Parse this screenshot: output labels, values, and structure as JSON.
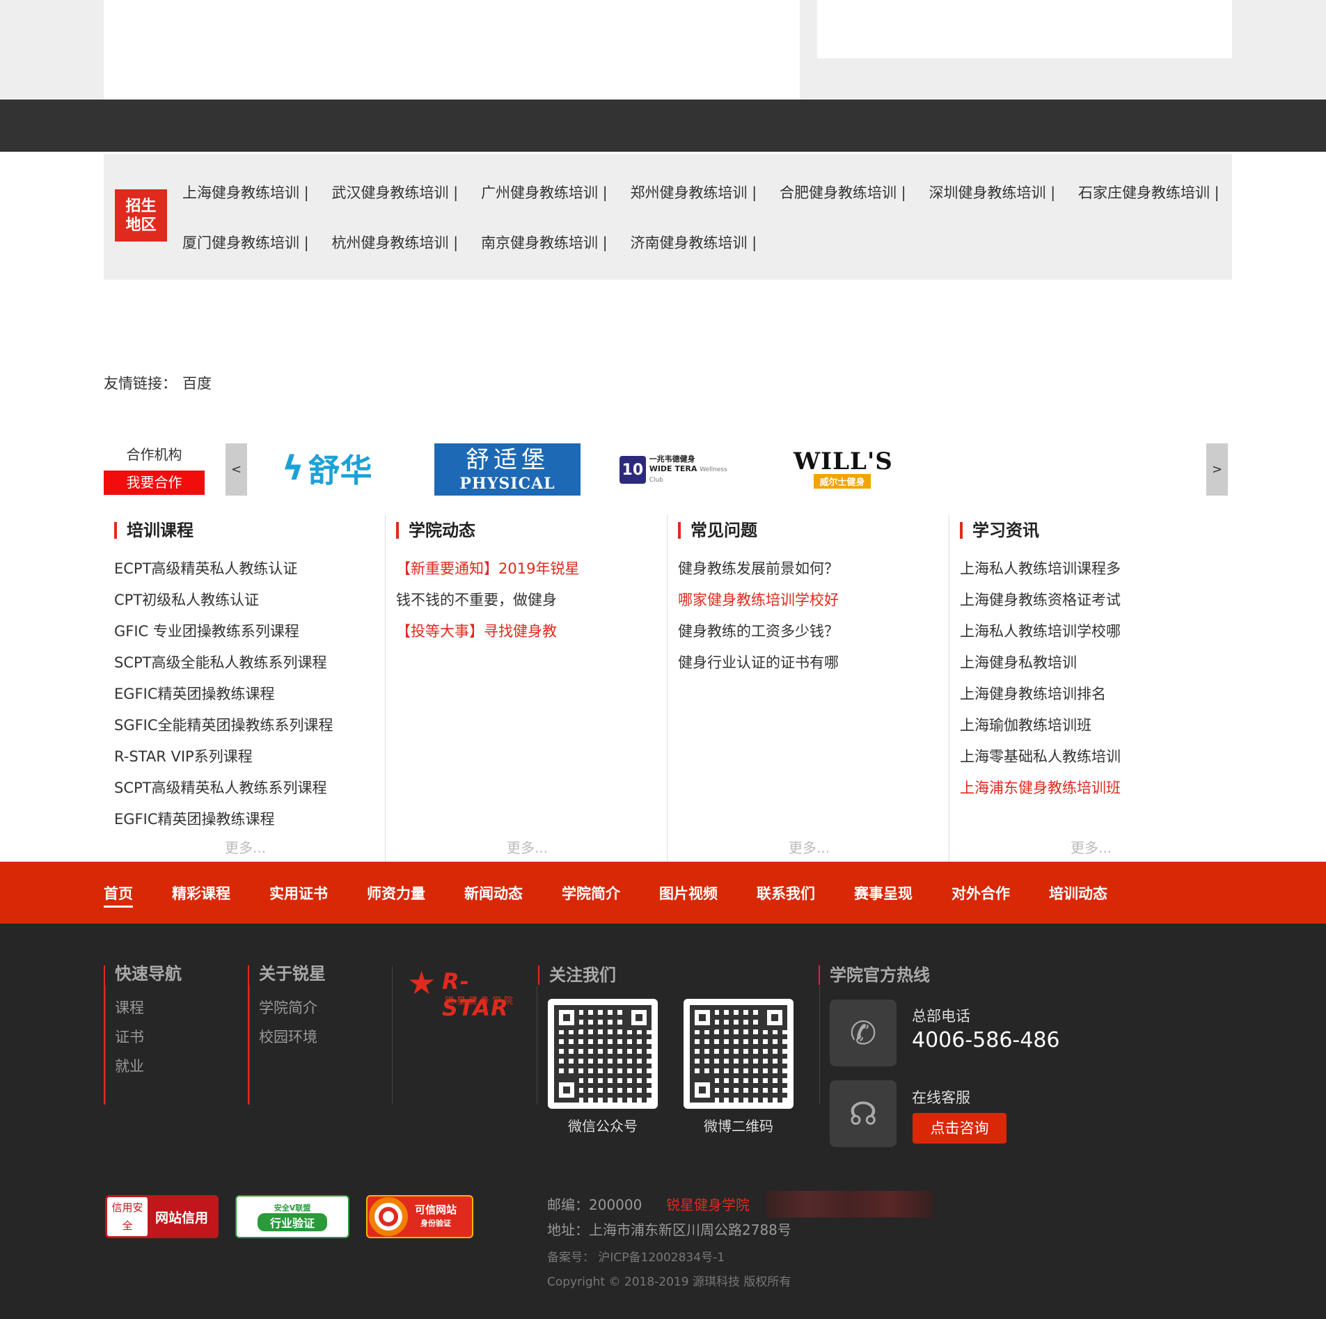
{
  "region": {
    "badge": "招生地区",
    "row1": [
      "上海健身教练培训",
      "武汉健身教练培训",
      "广州健身教练培训",
      "郑州健身教练培训",
      "合肥健身教练培训",
      "深圳健身教练培训",
      "石家庄健身教练培训"
    ],
    "row2": [
      "厦门健身教练培训",
      "杭州健身教练培训",
      "南京健身教练培训",
      "济南健身教练培训"
    ]
  },
  "friend_links": {
    "label": "友情链接：",
    "items": [
      "百度"
    ]
  },
  "partners": {
    "label": "合作机构",
    "button": "我要合作",
    "prev": "<",
    "next": ">",
    "logos": {
      "shuhua": "舒华",
      "physical_cn": "舒适堡",
      "physical_en": "PHYSICAL",
      "widetera_num": "10",
      "widetera_cn": "一兆韦德健身",
      "widetera_en": "WIDE TERA",
      "widetera_sub": "Wellness Club",
      "wills_en": "WILL'S",
      "wills_cn": "威尔士健身"
    }
  },
  "columns": [
    {
      "title": "培训课程",
      "items": [
        "ECPT高级精英私人教练认证",
        "CPT初级私人教练认证",
        "GFIC 专业团操教练系列课程",
        "SCPT高级全能私人教练系列课程",
        "EGFIC精英团操教练课程",
        "SGFIC全能精英团操教练系列课程",
        "R-STAR VIP系列课程",
        "SCPT高级精英私人教练系列课程",
        "EGFIC精英团操教练课程"
      ],
      "highlight": [],
      "more": "更多..."
    },
    {
      "title": "学院动态",
      "items": [
        "【新重要通知】2019年锐星",
        "钱不钱的不重要，做健身",
        "【投等大事】寻找健身教"
      ],
      "highlight": [
        0,
        2
      ],
      "more": "更多..."
    },
    {
      "title": "常见问题",
      "items": [
        "健身教练发展前景如何？",
        "哪家健身教练培训学校好",
        "健身教练的工资多少钱？",
        "健身行业认证的证书有哪"
      ],
      "highlight": [
        1
      ],
      "more": "更多..."
    },
    {
      "title": "学习资讯",
      "items": [
        "上海私人教练培训课程多",
        "上海健身教练资格证考试",
        "上海私人教练培训学校哪",
        "上海健身私教培训",
        "上海健身教练培训排名",
        "上海瑜伽教练培训班",
        "上海零基础私人教练培训",
        "上海浦东健身教练培训班"
      ],
      "highlight": [
        7
      ],
      "more": "更多..."
    }
  ],
  "nav": [
    "首页",
    "精彩课程",
    "实用证书",
    "师资力量",
    "新闻动态",
    "学院简介",
    "图片视频",
    "联系我们",
    "赛事呈现",
    "对外合作",
    "培训动态"
  ],
  "footer": {
    "quick_nav": {
      "title": "快速导航",
      "items": [
        "课程",
        "证书",
        "就业"
      ]
    },
    "about": {
      "title": "关于锐星",
      "items": [
        "学院简介",
        "校园环境"
      ]
    },
    "logo": {
      "name": "R-STAR",
      "sub": "锐星健身学院"
    },
    "follow": {
      "title": "关注我们",
      "qr1_caption": "微信公众号",
      "qr2_caption": "微博二维码"
    },
    "hotline": {
      "title": "学院官方热线",
      "phone_label": "总部电话",
      "phone": "4006-586-486",
      "cs_label": "在线客服",
      "cs_button": "点击咨询"
    },
    "badges": {
      "b1_box": "信用安全",
      "b1_text": "网站信用",
      "b2_top": "安全V联盟",
      "b2_main": "行业验证",
      "b3_main": "可信网站",
      "b3_sub": "身份验证"
    },
    "postcode": "邮编：200000",
    "brand": "锐星健身学院",
    "address": "地址：上海市浦东新区川周公路2788号",
    "icp": "备案号： 沪ICP备12002834号-1",
    "copyright": "Copyright © 2018-2019 源琪科技 版权所有"
  }
}
